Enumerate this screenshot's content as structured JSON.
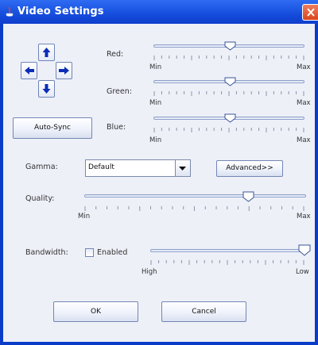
{
  "window": {
    "title": "Video Settings"
  },
  "dpad": {
    "up_icon": "arrow-up",
    "down_icon": "arrow-down",
    "left_icon": "arrow-left",
    "right_icon": "arrow-right"
  },
  "color": {
    "red_label": "Red:",
    "green_label": "Green:",
    "blue_label": "Blue:",
    "min_label": "Min",
    "max_label": "Max",
    "red_value": 0.5,
    "green_value": 0.5,
    "blue_value": 0.5
  },
  "auto_sync_label": "Auto-Sync",
  "gamma": {
    "label": "Gamma:",
    "value": "Default",
    "advanced_label": "Advanced>>"
  },
  "quality": {
    "label": "Quality:",
    "min_label": "Min",
    "max_label": "Max",
    "value": 0.75
  },
  "bandwidth": {
    "label": "Bandwidth:",
    "checkbox_label": "Enabled",
    "checked": false,
    "high_label": "High",
    "low_label": "Low",
    "value": 1.0
  },
  "buttons": {
    "ok": "OK",
    "cancel": "Cancel"
  },
  "colors": {
    "title_bar": "#2156e0",
    "client_bg": "#eef0f8",
    "arrow": "#0a2db8",
    "close_button": "#e25a32"
  }
}
